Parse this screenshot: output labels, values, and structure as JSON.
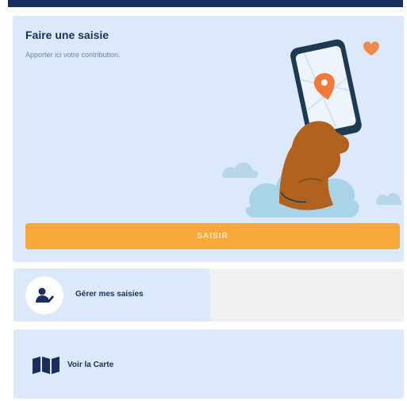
{
  "saisie_card": {
    "title": "Faire une saisie",
    "subtitle": "Apporter ici votre contribution.",
    "illustration": "hand-holding-phone-with-map-pin-illustration",
    "button_label": "SAISIR"
  },
  "gerer_card": {
    "label": "Gérer mes saisies",
    "icon": "user-edit-icon"
  },
  "carte_card": {
    "label": "Voir la Carte",
    "icon": "map-icon"
  },
  "colors": {
    "top_bar": "#17305e",
    "card_background": "#dbe9fa",
    "title_text": "#1b2f5e",
    "primary_button": "#f7a93b",
    "heart": "#f08a4b",
    "map_pin": "#f07a3a"
  }
}
